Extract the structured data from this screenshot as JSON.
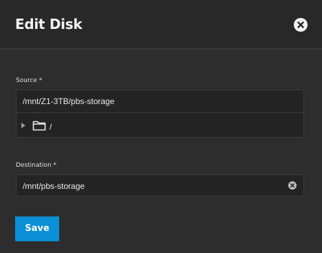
{
  "dialog": {
    "title": "Edit Disk",
    "close_icon": "close-icon"
  },
  "source": {
    "label": "Source *",
    "value": "/mnt/Z1-3TB/pbs-storage",
    "tree": {
      "expand_icon": "caret-right-icon",
      "folder_icon": "folder-icon",
      "node_label": "/"
    }
  },
  "destination": {
    "label": "Destination *",
    "value": "/mnt/pbs-storage",
    "clear_icon": "clear-icon"
  },
  "actions": {
    "save_label": "Save"
  },
  "colors": {
    "background": "#2d2d2d",
    "header": "#282828",
    "input_background": "#242424",
    "primary_button": "#0b8fd6"
  }
}
